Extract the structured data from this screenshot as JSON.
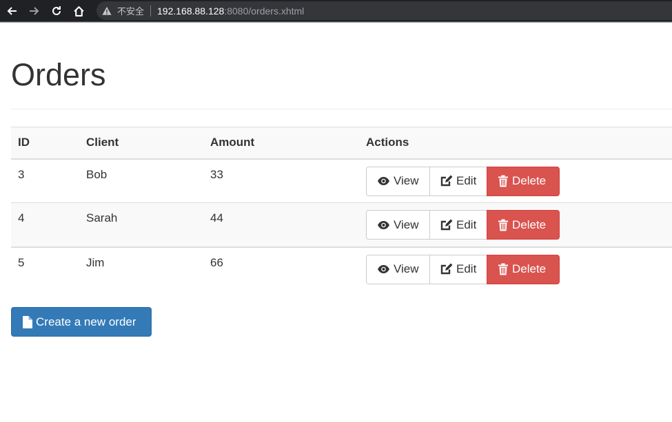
{
  "browser": {
    "insecure_label": "不安全",
    "url_host": "192.168.88.128",
    "url_rest": ":8080/orders.xhtml"
  },
  "page": {
    "title": "Orders"
  },
  "table": {
    "headers": [
      "ID",
      "Client",
      "Amount",
      "Actions"
    ],
    "rows": [
      {
        "id": "3",
        "client": "Bob",
        "amount": "33"
      },
      {
        "id": "4",
        "client": "Sarah",
        "amount": "44"
      },
      {
        "id": "5",
        "client": "Jim",
        "amount": "66"
      }
    ],
    "actions": {
      "view_label": "View",
      "edit_label": "Edit",
      "delete_label": "Delete"
    }
  },
  "create_button": {
    "label": "Create a new order"
  },
  "colors": {
    "primary": "#337ab7",
    "danger": "#d9534f",
    "browser_dark": "#202124"
  },
  "icons": {
    "view": "eye-icon",
    "edit": "edit-icon",
    "delete": "trash-icon",
    "create": "file-icon"
  }
}
